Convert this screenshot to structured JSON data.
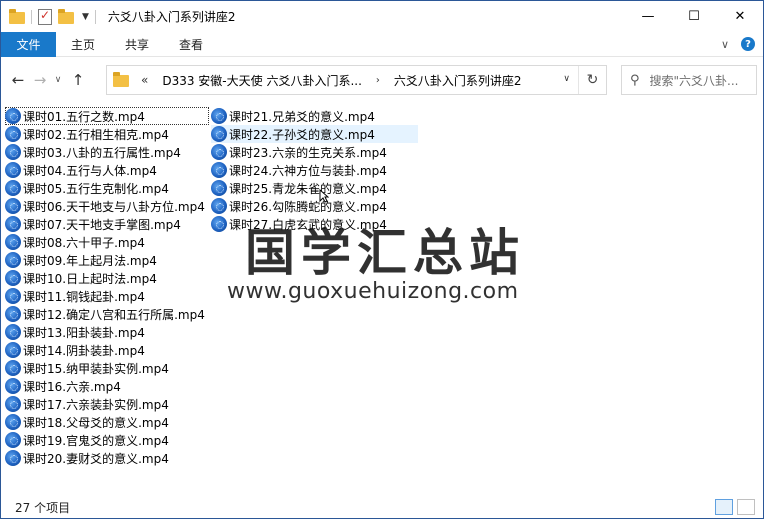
{
  "window": {
    "title": "六爻八卦入门系列讲座2",
    "minimize": "—",
    "maximize": "☐",
    "close": "✕"
  },
  "ribbon": {
    "tabs": [
      "文件",
      "主页",
      "共享",
      "查看"
    ],
    "help": "?"
  },
  "address": {
    "overflow": "«",
    "crumbs": [
      "D333 安徽-大天使 六爻八卦入门系...",
      "六爻八卦入门系列讲座2"
    ],
    "separator": "›"
  },
  "search": {
    "placeholder": "搜索\"六爻八卦..."
  },
  "files": {
    "column1": [
      "课时01.五行之数.mp4",
      "课时02.五行相生相克.mp4",
      "课时03.八卦的五行属性.mp4",
      "课时04.五行与人体.mp4",
      "课时05.五行生克制化.mp4",
      "课时06.天干地支与八卦方位.mp4",
      "课时07.天干地支手掌图.mp4",
      "课时08.六十甲子.mp4",
      "课时09.年上起月法.mp4",
      "课时10.日上起时法.mp4",
      "课时11.铜钱起卦.mp4",
      "课时12.确定八宫和五行所属.mp4",
      "课时13.阳卦装卦.mp4",
      "课时14.阴卦装卦.mp4",
      "课时15.纳甲装卦实例.mp4",
      "课时16.六亲.mp4",
      "课时17.六亲装卦实例.mp4",
      "课时18.父母爻的意义.mp4",
      "课时19.官鬼爻的意义.mp4",
      "课时20.妻财爻的意义.mp4"
    ],
    "column2": [
      "课时21.兄弟爻的意义.mp4",
      "课时22.子孙爻的意义.mp4",
      "课时23.六亲的生克关系.mp4",
      "课时24.六神方位与装卦.mp4",
      "课时25.青龙朱雀的意义.mp4",
      "课时26.勾陈腾蛇的意义.mp4",
      "课时27.白虎玄武的意义.mp4"
    ]
  },
  "watermark": {
    "title": "国学汇总站",
    "url": "www.guoxuehuizong.com"
  },
  "status": {
    "count": "27 个项目"
  },
  "colors": {
    "accent": "#1979ca",
    "hover": "#e5f3ff",
    "folder": "#f3c044"
  }
}
